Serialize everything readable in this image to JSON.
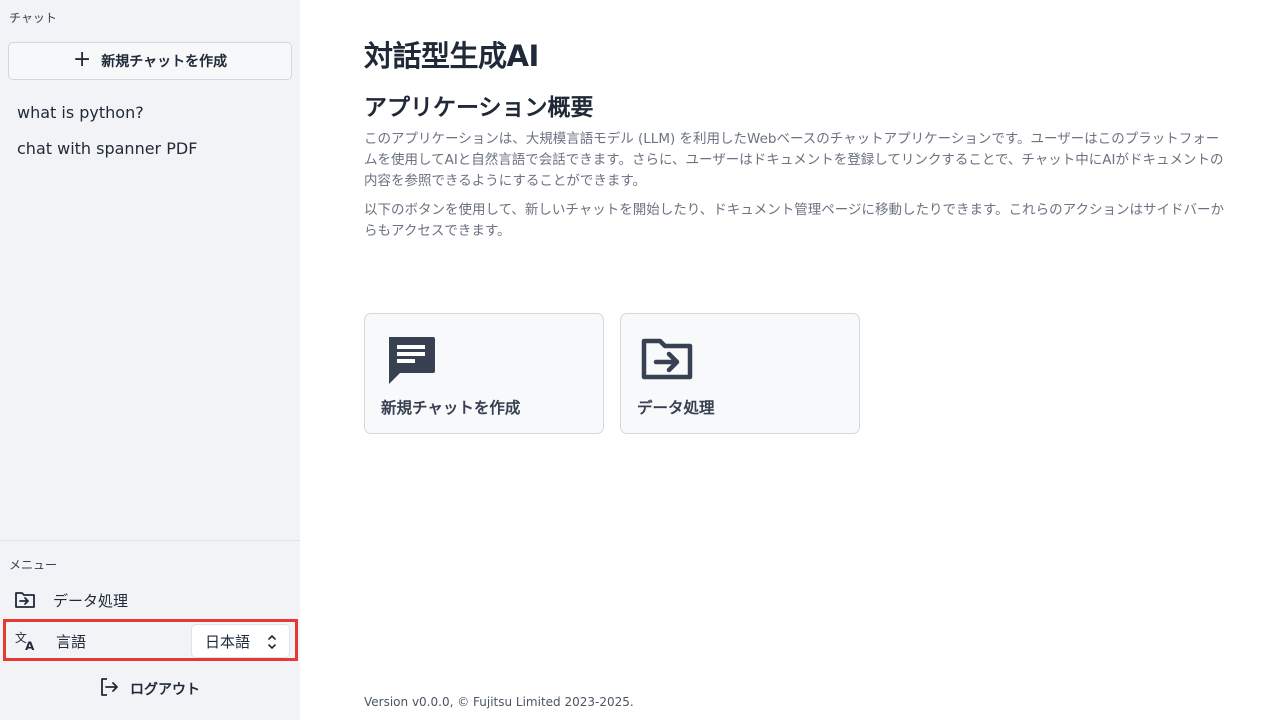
{
  "sidebar": {
    "chat_section_label": "チャット",
    "new_chat_label": "新規チャットを作成",
    "chats": [
      "what is python?",
      "chat with spanner PDF"
    ],
    "menu_section_label": "メニュー",
    "data_processing_label": "データ処理",
    "language_label": "言語",
    "language_value": "日本語",
    "logout_label": "ログアウト"
  },
  "main": {
    "title": "対話型生成AI",
    "section_title": "アプリケーション概要",
    "paragraph1": "このアプリケーションは、大規模言語モデル (LLM) を利用したWebベースのチャットアプリケーションです。ユーザーはこのプラットフォームを使用してAIと自然言語で会話できます。さらに、ユーザーはドキュメントを登録してリンクすることで、チャット中にAIがドキュメントの内容を参照できるようにすることができます。",
    "paragraph2": "以下のボタンを使用して、新しいチャットを開始したり、ドキュメント管理ページに移動したりできます。これらのアクションはサイドバーからもアクセスできます。",
    "cards": [
      {
        "label": "新規チャットを作成",
        "icon": "chat-icon"
      },
      {
        "label": "データ処理",
        "icon": "folder-arrow-icon"
      }
    ],
    "footer": "Version v0.0.0, © Fujitsu Limited 2023-2025."
  },
  "colors": {
    "sidebar_bg": "#f1f3f6",
    "highlight_border": "#e53935",
    "icon_dark": "#374151"
  }
}
